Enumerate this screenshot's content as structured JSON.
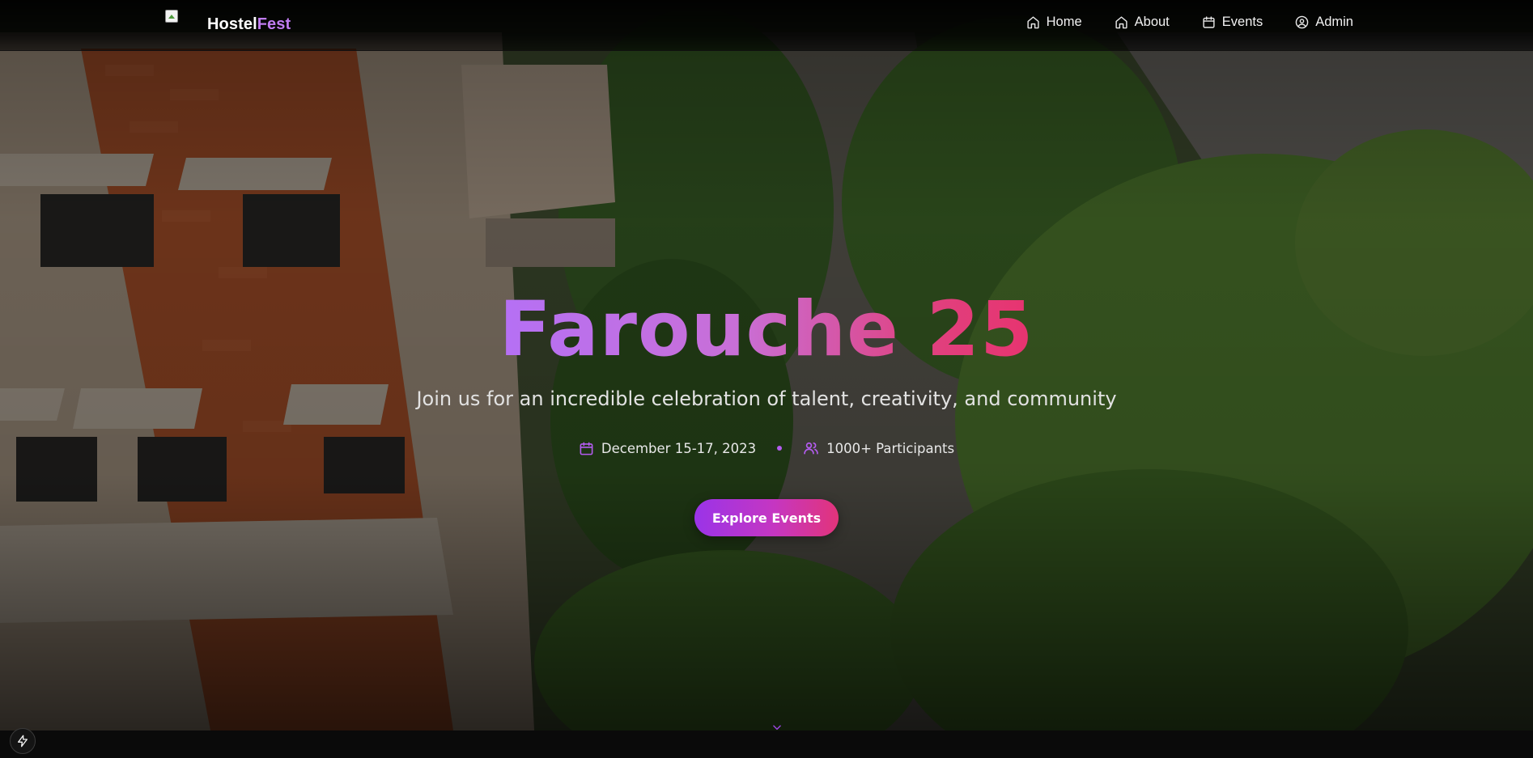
{
  "navbar": {
    "brand_prefix": "Hostel",
    "brand_accent": "Fest",
    "links": [
      {
        "label": "Home",
        "icon": "home-icon"
      },
      {
        "label": "About",
        "icon": "home-icon"
      },
      {
        "label": "Events",
        "icon": "calendar-icon"
      },
      {
        "label": "Admin",
        "icon": "user-circle-icon"
      }
    ]
  },
  "hero": {
    "title": "Farouche 25",
    "subtitle": "Join us for an incredible celebration of talent, creativity, and community",
    "date": "December 15-17, 2023",
    "participants": "1000+ Participants",
    "cta_label": "Explore Events"
  },
  "icons": {
    "date": "calendar-icon",
    "participants": "users-icon",
    "scroll": "chevron-down-icon",
    "corner": "lightning-icon"
  },
  "colors": {
    "brand_accent": "#c07cf2",
    "title_gradient_start": "#b570f5",
    "title_gradient_end": "#e7336f",
    "cta_gradient_start": "#9a34e8",
    "cta_gradient_end": "#e2347a",
    "meta_accent": "#b45cf0"
  }
}
